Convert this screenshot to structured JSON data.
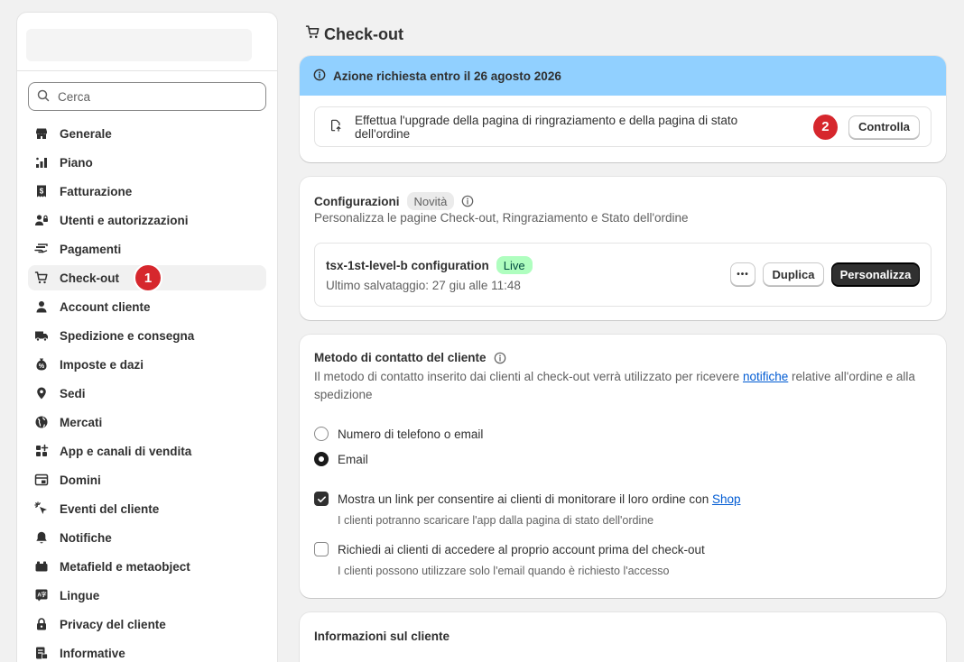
{
  "sidebar": {
    "search_placeholder": "Cerca",
    "items": [
      {
        "label": "Generale",
        "icon": "store-icon"
      },
      {
        "label": "Piano",
        "icon": "plan-icon"
      },
      {
        "label": "Fatturazione",
        "icon": "billing-icon"
      },
      {
        "label": "Utenti e autorizzazioni",
        "icon": "users-icon"
      },
      {
        "label": "Pagamenti",
        "icon": "payments-icon"
      },
      {
        "label": "Check-out",
        "icon": "cart-icon",
        "active": true,
        "step": "1"
      },
      {
        "label": "Account cliente",
        "icon": "person-icon"
      },
      {
        "label": "Spedizione e consegna",
        "icon": "truck-icon"
      },
      {
        "label": "Imposte e dazi",
        "icon": "tax-icon"
      },
      {
        "label": "Sedi",
        "icon": "location-icon"
      },
      {
        "label": "Mercati",
        "icon": "globe-icon"
      },
      {
        "label": "App e canali di vendita",
        "icon": "apps-icon"
      },
      {
        "label": "Domini",
        "icon": "domain-icon"
      },
      {
        "label": "Eventi del cliente",
        "icon": "cursor-icon"
      },
      {
        "label": "Notifiche",
        "icon": "bell-icon"
      },
      {
        "label": "Metafield e metaobject",
        "icon": "metafield-icon"
      },
      {
        "label": "Lingue",
        "icon": "language-icon"
      },
      {
        "label": "Privacy del cliente",
        "icon": "lock-icon"
      },
      {
        "label": "Informative",
        "icon": "policy-icon"
      }
    ]
  },
  "page": {
    "title": "Check-out"
  },
  "banner": {
    "title": "Azione richiesta entro il 26 agosto 2026",
    "message": "Effettua l'upgrade della pagina di ringraziamento e della pagina di stato dell'ordine",
    "step": "2",
    "button": "Controlla"
  },
  "configurations": {
    "title": "Configurazioni",
    "badge": "Novità",
    "description": "Personalizza le pagine Check-out, Ringraziamento e Stato dell'ordine",
    "config_name": "tsx-1st-level-b configuration",
    "status": "Live",
    "last_saved": "Ultimo salvataggio: 27 giu alle 11:48",
    "more_label": "•••",
    "duplicate": "Duplica",
    "customize": "Personalizza"
  },
  "contact": {
    "title": "Metodo di contatto del cliente",
    "description_pre": "Il metodo di contatto inserito dai clienti al check-out verrà utilizzato per ricevere ",
    "description_link": "notifiche",
    "description_post": " relative all'ordine e alla spedizione",
    "options": [
      {
        "label": "Numero di telefono o email",
        "checked": false
      },
      {
        "label": "Email",
        "checked": true
      }
    ],
    "shop_check": {
      "label_pre": "Mostra un link per consentire ai clienti di monitorare il loro ordine con ",
      "label_link": "Shop",
      "help": "I clienti potranno scaricare l'app dalla pagina di stato dell'ordine",
      "checked": true
    },
    "login_check": {
      "label": "Richiedi ai clienti di accedere al proprio account prima del check-out",
      "help": "I clienti possono utilizzare solo l'email quando è richiesto l'accesso",
      "checked": false
    }
  },
  "customer_info": {
    "title": "Informazioni sul cliente"
  }
}
